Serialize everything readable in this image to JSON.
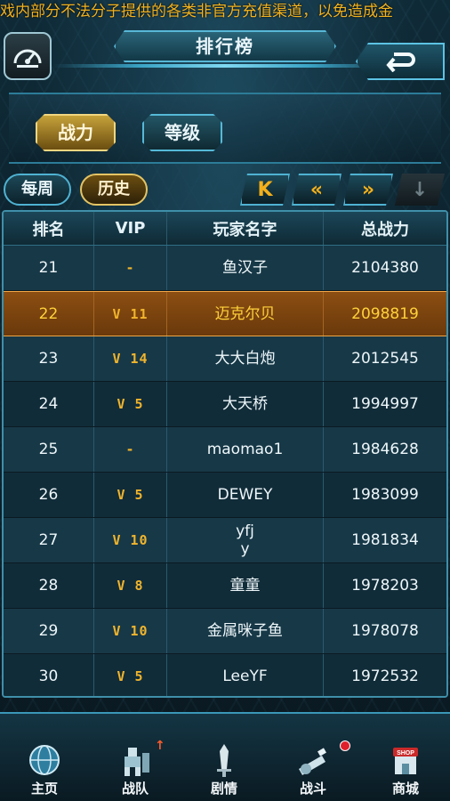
{
  "marquee": "戏内部分不法分子提供的各类非官方充值渠道，以免造成金",
  "header": {
    "title": "排行榜",
    "settings_icon": "speedometer-icon",
    "back_icon": "return-arrow-icon"
  },
  "category_tabs": [
    {
      "label": "战力",
      "active": true
    },
    {
      "label": "等级",
      "active": false
    }
  ],
  "period_tabs": [
    {
      "label": "每周",
      "active": false
    },
    {
      "label": "历史",
      "active": true
    }
  ],
  "pager": {
    "first": "K",
    "prev": "«",
    "next": "»",
    "last": "↓"
  },
  "table": {
    "headers": [
      "排名",
      "VIP",
      "玩家名字",
      "总战力"
    ],
    "rows": [
      {
        "rank": "21",
        "vip": "-",
        "name": "鱼汉子",
        "power": "2104380"
      },
      {
        "rank": "22",
        "vip": "V 11",
        "name": "迈克尔贝",
        "power": "2098819",
        "highlight": true
      },
      {
        "rank": "23",
        "vip": "V 14",
        "name": "大大白炮",
        "power": "2012545"
      },
      {
        "rank": "24",
        "vip": "V 5",
        "name": "大天桥",
        "power": "1994997"
      },
      {
        "rank": "25",
        "vip": "-",
        "name": "maomao1",
        "power": "1984628"
      },
      {
        "rank": "26",
        "vip": "V 5",
        "name": "DEWEY",
        "power": "1983099"
      },
      {
        "rank": "27",
        "vip": "V 10",
        "name": "yfj\ny",
        "power": "1981834"
      },
      {
        "rank": "28",
        "vip": "V 8",
        "name": "童童",
        "power": "1978203"
      },
      {
        "rank": "29",
        "vip": "V 10",
        "name": "金属咪子鱼",
        "power": "1978078"
      },
      {
        "rank": "30",
        "vip": "V 5",
        "name": "LeeYF",
        "power": "1972532"
      }
    ]
  },
  "nav": [
    {
      "label": "主页",
      "icon": "globe-icon"
    },
    {
      "label": "战队",
      "icon": "mecha-team-icon"
    },
    {
      "label": "剧情",
      "icon": "sword-icon"
    },
    {
      "label": "战斗",
      "icon": "cannon-icon"
    },
    {
      "label": "商城",
      "icon": "shop-icon"
    }
  ],
  "colors": {
    "accent_gold": "#f1b52c",
    "highlight_row": "#8c4e12",
    "frame_cyan": "#3f8fa9"
  }
}
